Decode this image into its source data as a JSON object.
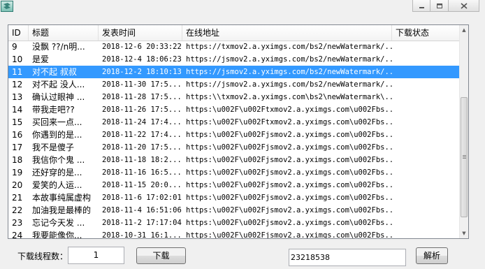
{
  "window": {
    "icon": "app-icon",
    "controls": [
      "minimize-icon",
      "maximize-icon",
      "close-icon"
    ]
  },
  "table": {
    "columns": [
      "ID",
      "标题",
      "发表时间",
      "在线地址",
      "下载状态"
    ],
    "selected_row": 2,
    "rows": [
      {
        "id": "9",
        "title": "没飘 ??/n明...",
        "time": "2018-12-6 20:33:22",
        "url": "https://txmov2.a.yximgs.com/bs2/newWatermark/...",
        "status": ""
      },
      {
        "id": "10",
        "title": "是爱",
        "time": "2018-12-4 18:06:23",
        "url": "https://jsmov2.a.yximgs.com/bs2/newWatermark/...",
        "status": ""
      },
      {
        "id": "11",
        "title": "对不起 叔叔",
        "time": "2018-12-2 18:10:13",
        "url": "https://jsmov2.a.yximgs.com/bs2/newWatermark/...",
        "status": ""
      },
      {
        "id": "12",
        "title": "对不起 没人...",
        "time": "2018-11-30 17:5...",
        "url": "https://jsmov2.a.yximgs.com/bs2/newWatermark/...",
        "status": ""
      },
      {
        "id": "13",
        "title": "确认过眼神 ...",
        "time": "2018-11-28 17:5...",
        "url": "https:\\\\txmov2.a.yximgs.com\\bs2\\newWatermark\\...",
        "status": ""
      },
      {
        "id": "14",
        "title": "带我走吧??",
        "time": "2018-11-26 17:5...",
        "url": "https:\\u002F\\u002Ftxmov2.a.yximgs.com\\u002Fbs...",
        "status": ""
      },
      {
        "id": "15",
        "title": "买回来一点...",
        "time": "2018-11-24 17:4...",
        "url": "https:\\u002F\\u002Ftxmov2.a.yximgs.com\\u002Fbs...",
        "status": ""
      },
      {
        "id": "16",
        "title": "你遇到的是...",
        "time": "2018-11-22 17:4...",
        "url": "https:\\u002F\\u002Fjsmov2.a.yximgs.com\\u002Fbs...",
        "status": ""
      },
      {
        "id": "17",
        "title": "我不是傻子",
        "time": "2018-11-20 17:5...",
        "url": "https:\\u002F\\u002Fjsmov2.a.yximgs.com\\u002Fbs...",
        "status": ""
      },
      {
        "id": "18",
        "title": "我信你个鬼 ...",
        "time": "2018-11-18 18:2...",
        "url": "https:\\u002F\\u002Fjsmov2.a.yximgs.com\\u002Fbs...",
        "status": ""
      },
      {
        "id": "19",
        "title": "还好穿的是...",
        "time": "2018-11-16 16:5...",
        "url": "https:\\u002F\\u002Fjsmov2.a.yximgs.com\\u002Fbs...",
        "status": ""
      },
      {
        "id": "20",
        "title": "爱笑的人运...",
        "time": "2018-11-15 20:0...",
        "url": "https:\\u002F\\u002Fjsmov2.a.yximgs.com\\u002Fbs...",
        "status": ""
      },
      {
        "id": "21",
        "title": "本故事纯属虚构",
        "time": "2018-11-6 17:02:01",
        "url": "https:\\u002F\\u002Fjsmov2.a.yximgs.com\\u002Fbs...",
        "status": ""
      },
      {
        "id": "22",
        "title": "加油我是最棒的",
        "time": "2018-11-4 16:51:06",
        "url": "https:\\u002F\\u002Fjsmov2.a.yximgs.com\\u002Fbs...",
        "status": ""
      },
      {
        "id": "23",
        "title": "忘记今天发 ...",
        "time": "2018-11-2 17:17:04",
        "url": "https:\\u002F\\u002Fjsmov2.a.yximgs.com\\u002Fbs...",
        "status": ""
      },
      {
        "id": "24",
        "title": "我要能像你...",
        "time": "2018-10-31 16:1...",
        "url": "https:\\u002F\\u002Fjsmov2.a.yximgs.com\\u002Fbs...",
        "status": ""
      }
    ]
  },
  "footer": {
    "threads_label": "下载线程数：",
    "threads_value": "1",
    "download_label": "下载",
    "id_value": "23218538",
    "parse_label": "解析"
  },
  "colors": {
    "selection": "#3399ff",
    "window_bg": "#f0f0f0"
  }
}
